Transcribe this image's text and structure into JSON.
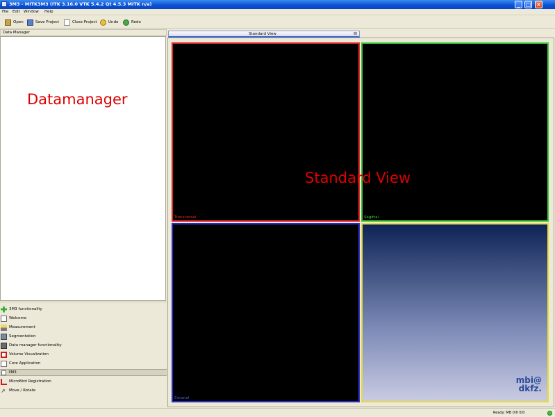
{
  "window": {
    "title": "3M3 - MITK3M3 (ITK 3.16.0  VTK 5.4.2 Qt 4.5.3 MITK n/a)",
    "minimize": "_",
    "maximize": "□",
    "close": "×"
  },
  "menu": [
    "File",
    "Edit",
    "Window",
    "Help"
  ],
  "toolbar": {
    "open": "Open",
    "save_project": "Save Project",
    "close_project": "Close Project",
    "undo": "Undo",
    "redo": "Redo"
  },
  "data_manager": {
    "header": "Data Manager",
    "annotation": "Datamanager"
  },
  "functionalities": [
    "3M3 functionality",
    "Welcome",
    "Measurement",
    "Segmentation",
    "Data manager functionality",
    "Volume Visualization",
    "Core Application"
  ],
  "separator": "3M3",
  "lower_items": [
    "MicroBird Registration",
    "Move / Rotate"
  ],
  "view": {
    "tab_label": "Standard View",
    "tab_close": "⊠",
    "annotation": "Standard View",
    "windows": {
      "axial": "Transversal",
      "sagittal": "Sagittal",
      "coronal": "Coronal"
    },
    "logo_line1": "mbi@",
    "logo_line2": "dkfz."
  },
  "status": {
    "text": "Ready: MB 0/0 0/0"
  },
  "colors": {
    "axial_border": "#e02828",
    "sagittal_border": "#3cc83c",
    "coronal_border": "#2a2ac8",
    "3d_border": "#e8dc3c",
    "annotation": "#e00000"
  }
}
